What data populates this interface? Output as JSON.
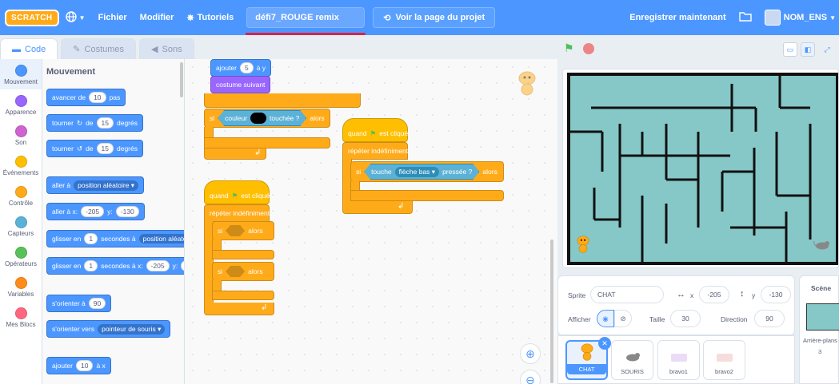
{
  "menubar": {
    "logo": "SCRATCH",
    "language_icon": "globe-icon",
    "file": "Fichier",
    "edit": "Modifier",
    "tutorials": "Tutoriels",
    "project_title": "défi7_ROUGE remix",
    "see_project": "Voir la page du projet",
    "save_now": "Enregistrer maintenant",
    "username": "NOM_ENS"
  },
  "tabs": {
    "code": "Code",
    "costumes": "Costumes",
    "sounds": "Sons"
  },
  "categories": [
    {
      "label": "Mouvement",
      "color": "#4c97ff"
    },
    {
      "label": "Apparence",
      "color": "#9966ff"
    },
    {
      "label": "Son",
      "color": "#cf63cf"
    },
    {
      "label": "Événements",
      "color": "#ffbf00"
    },
    {
      "label": "Contrôle",
      "color": "#ffab19"
    },
    {
      "label": "Capteurs",
      "color": "#5cb1d6"
    },
    {
      "label": "Opérateurs",
      "color": "#59c059"
    },
    {
      "label": "Variables",
      "color": "#ff8c1a"
    },
    {
      "label": "Mes Blocs",
      "color": "#ff6680"
    }
  ],
  "palette": {
    "title": "Mouvement",
    "move_a": "avancer de",
    "move_val": "10",
    "move_b": "pas",
    "turn_r_a": "tourner",
    "turn_r_b": "de",
    "turn_r_val": "15",
    "turn_r_c": "degrés",
    "turn_l_a": "tourner",
    "turn_l_b": "de",
    "turn_l_val": "15",
    "turn_l_c": "degrés",
    "goto_a": "aller à",
    "goto_dd": "position aléatoire",
    "gotoxy_a": "aller à x:",
    "gotoxy_x": "-205",
    "gotoxy_b": "y:",
    "gotoxy_y": "-130",
    "glide_a": "glisser en",
    "glide_val": "1",
    "glide_b": "secondes à",
    "glide_dd": "position aléatoire",
    "glidexy_a": "glisser en",
    "glidexy_val": "1",
    "glidexy_b": "secondes à x:",
    "glidexy_x": "-205",
    "glidexy_c": "y:",
    "glidexy_y": "-1",
    "point_a": "s'orienter à",
    "point_val": "90",
    "pointto_a": "s'orienter vers",
    "pointto_dd": "pointeur de souris",
    "changex_a": "ajouter",
    "changex_val": "10",
    "changex_b": "à x"
  },
  "script1": {
    "add_a": "ajouter",
    "add_val": "5",
    "add_b": "à y",
    "costume": "costume suivant",
    "if": "si",
    "touch_a": "couleur",
    "touch_b": "touchée ?",
    "then": "alors"
  },
  "script2": {
    "when": "quand",
    "clicked": "est cliqué",
    "forever": "répéter indéfiniment",
    "if1": "si",
    "then1": "alors",
    "if2": "si",
    "then2": "alors"
  },
  "script3": {
    "when": "quand",
    "clicked": "est cliqué",
    "forever": "répéter indéfiniment",
    "if": "si",
    "key_a": "touche",
    "key_dd": "flèche bas",
    "key_b": "pressée ?",
    "then": "alors"
  },
  "sprite_info": {
    "sprite_label": "Sprite",
    "sprite_name": "CHAT",
    "x_label": "x",
    "x_val": "-205",
    "y_label": "y",
    "y_val": "-130",
    "show_label": "Afficher",
    "size_label": "Taille",
    "size_val": "30",
    "dir_label": "Direction",
    "dir_val": "90"
  },
  "sprites": [
    {
      "name": "CHAT"
    },
    {
      "name": "SOURIS"
    },
    {
      "name": "bravo1"
    },
    {
      "name": "bravo2"
    }
  ],
  "scene": {
    "title": "Scène",
    "backdrops_label": "Arrière-plans",
    "backdrops_count": "3"
  }
}
